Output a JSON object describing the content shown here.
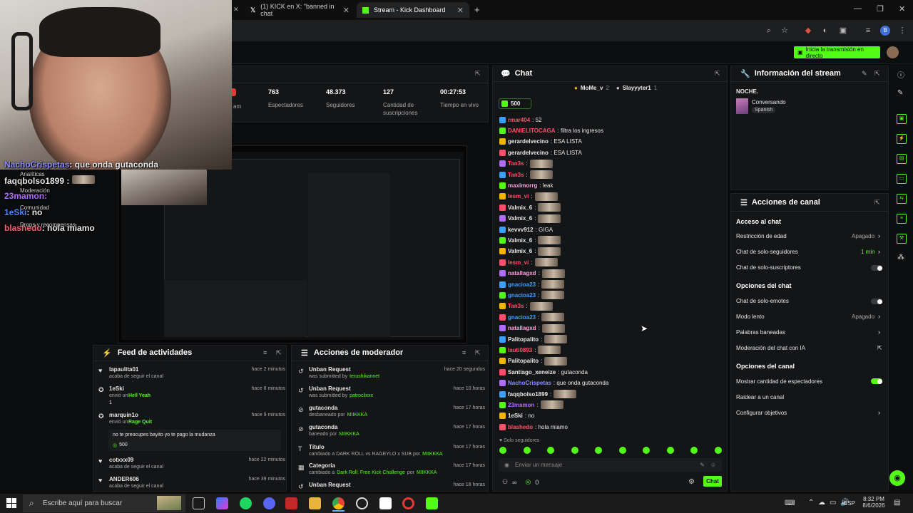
{
  "browser": {
    "tab1": "(1) KICK en X: \"banned in chat",
    "tab2": "Stream - Kick Dashboard",
    "new_tab": "+",
    "min": "—",
    "max": "❐",
    "close": "✕"
  },
  "topbar": {
    "go_live": "Inicia la transmisión en directo"
  },
  "stats": [
    {
      "value": "763",
      "label": "Espectadores"
    },
    {
      "value": "48.373",
      "label": "Seguidores"
    },
    {
      "value": "127",
      "label": "Cantidad de suscripciones"
    },
    {
      "value": "00:27:53",
      "label": "Tiempo en vivo"
    }
  ],
  "stats_partial": "am",
  "overlay": {
    "chat": [
      {
        "user": "NachoCrispetas",
        "text": ": que onda gutaconda",
        "color": "#8f8cff"
      },
      {
        "user": "faqqbolso1899",
        "text": " :",
        "color": "#e8e8e8"
      },
      {
        "user": "1eSki",
        "text": ": no",
        "color": "#4a86ff"
      },
      {
        "user": "blashedo",
        "text": ": hola miamo",
        "color": "#ff5d7a"
      },
      {
        "user": "23mamon",
        "text": ":",
        "color": "#b06cff"
      }
    ],
    "menu": [
      "Analíticas",
      "Moderación",
      "Comunidad",
      "Drops y recompensas"
    ]
  },
  "chat": {
    "title": "Chat",
    "pinned": [
      "MoMe_v",
      "2",
      "Slayyyter1",
      "1"
    ],
    "goal": "500",
    "messages": [
      {
        "user": "rmar404",
        "text": ": 52",
        "color": "#ff4f6b"
      },
      {
        "user": "DANIELITOCAGA",
        "text": ": filtra los ingresos",
        "color": "#ff4f6b"
      },
      {
        "user": "gerardelvecino",
        "text": ": ESA LISTA",
        "color": "#e8e8e8"
      },
      {
        "user": "gerardelvecino",
        "text": ": ESA LISTA",
        "color": "#e8e8e8"
      },
      {
        "user": "Tan3s",
        "text": ":",
        "color": "#ff4f6b"
      },
      {
        "user": "Tan3s",
        "text": ":",
        "color": "#ff4f6b"
      },
      {
        "user": "maximorrg",
        "text": ": leak",
        "color": "#ff9fdf"
      },
      {
        "user": "lesm_vi",
        "text": ":",
        "color": "#ff4f6b"
      },
      {
        "user": "Valmix_6",
        "text": ":",
        "color": "#e8e8e8"
      },
      {
        "user": "Valmix_6",
        "text": ":",
        "color": "#e8e8e8"
      },
      {
        "user": "kevvv912",
        "text": ": GIGA",
        "color": "#e8e8e8"
      },
      {
        "user": "Valmix_6",
        "text": ":",
        "color": "#e8e8e8"
      },
      {
        "user": "Valmix_6",
        "text": ":",
        "color": "#e8e8e8"
      },
      {
        "user": "lesm_vi",
        "text": ":",
        "color": "#ff4f6b"
      },
      {
        "user": "natallagxd",
        "text": ":",
        "color": "#ff9fdf"
      },
      {
        "user": "gnacioa23",
        "text": ":",
        "color": "#3aa0ff"
      },
      {
        "user": "gnacioa23",
        "text": ":",
        "color": "#3aa0ff"
      },
      {
        "user": "Tan3s",
        "text": ":",
        "color": "#ff4f6b"
      },
      {
        "user": "gnacioa23",
        "text": ":",
        "color": "#3aa0ff"
      },
      {
        "user": "natallagxd",
        "text": ":",
        "color": "#ff9fdf"
      },
      {
        "user": "Palitopalito",
        "text": ":",
        "color": "#e8e8e8"
      },
      {
        "user": "lauti0893",
        "text": ":",
        "color": "#ff4f6b"
      },
      {
        "user": "Palitopalito",
        "text": ":",
        "color": "#e8e8e8"
      },
      {
        "user": "Santiago_xeneize",
        "text": ": gutaconda",
        "color": "#e8e8e8"
      },
      {
        "user": "NachoCrispetas",
        "text": ": que onda gutaconda",
        "color": "#8f8cff"
      },
      {
        "user": "faqqbolso1899",
        "text": ":",
        "color": "#e8e8e8"
      },
      {
        "user": "23mamon",
        "text": ":",
        "color": "#b06cff"
      },
      {
        "user": "1eSki",
        "text": ": no",
        "color": "#e8e8e8"
      },
      {
        "user": "blashedo",
        "text": ": hola miamo",
        "color": "#ff4f6b"
      }
    ],
    "followers_only": "Solo seguidores",
    "placeholder": "Enviar un mensaje",
    "points": "0",
    "send": "Chat"
  },
  "info": {
    "title": "Información del stream",
    "stream_title": "NOCHE.",
    "category": "Conversando",
    "tag": "Spanish"
  },
  "actions": {
    "title": "Acciones de canal",
    "access": "Acceso al chat",
    "age": "Restricción de edad",
    "age_val": "Apagado",
    "followers": "Chat de solo-seguidores",
    "followers_val": "1 min",
    "subs": "Chat de solo-suscriptores",
    "chat_opts": "Opciones del chat",
    "emotes": "Chat de solo-emotes",
    "slow": "Modo lento",
    "slow_val": "Apagado",
    "banned": "Palabras baneadas",
    "ai": "Moderación del chat con IA",
    "channel_opts": "Opciones del canal",
    "viewers": "Mostrar cantidad de espectadores",
    "raid": "Raidear a un canal",
    "goals": "Configurar objetivos"
  },
  "feed": {
    "title": "Feed de actividades",
    "items": [
      {
        "user": "lapaulita01",
        "sub": "acaba de seguir el canal",
        "time": "hace 2 minutos"
      },
      {
        "user": "1eSki",
        "sub": "envió un",
        "extra": "Hell Yeah",
        "count": "1",
        "time": "hace 8 minutos"
      },
      {
        "user": "marquin1o",
        "sub": "envió un",
        "extra": "Rage Quit",
        "time": "hace 9 minutos"
      },
      {
        "user": "cotxxx09",
        "sub": "acaba de seguir el canal",
        "time": "hace 22 minutos"
      },
      {
        "user": "ANDER606",
        "sub": "acaba de seguir el canal",
        "time": "hace 39 minutos"
      }
    ],
    "note": "no te preocupes bayito yo te pago la mudanza",
    "note_amount": "500"
  },
  "mod": {
    "title": "Acciones de moderador",
    "items": [
      {
        "action": "Unban Request",
        "sub": "was submitted by",
        "who": "terushikannet",
        "time": "hace 20 segundos"
      },
      {
        "action": "Unban Request",
        "sub": "was submitted by",
        "who": "patroclixxx",
        "time": "hace 10 horas"
      },
      {
        "action": "gutaconda",
        "sub": "desbaneado por",
        "who": "MIIKKKA",
        "time": "hace 17 horas"
      },
      {
        "action": "gutaconda",
        "sub": "baneado por",
        "who": "MIIKKKA",
        "time": "hace 17 horas"
      },
      {
        "action": "Título",
        "sub": "cambiado a DARK ROLL vs RAGEYLO x SUB por",
        "who": "MIIKKKA",
        "time": "hace 17 horas"
      },
      {
        "action": "Categoría",
        "sub": "cambiado a",
        "who": "Dark Roll: Free Kick Challenge",
        "sub2": "por",
        "who2": "MIIKKKA",
        "time": "hace 17 horas"
      },
      {
        "action": "Unban Request",
        "sub": "",
        "who": "",
        "time": "hace 18 horas"
      }
    ]
  },
  "taskbar": {
    "search": "Escribe aquí para buscar",
    "lang": "ESP",
    "time": "8:32 PM",
    "date": "8/6/2026"
  }
}
